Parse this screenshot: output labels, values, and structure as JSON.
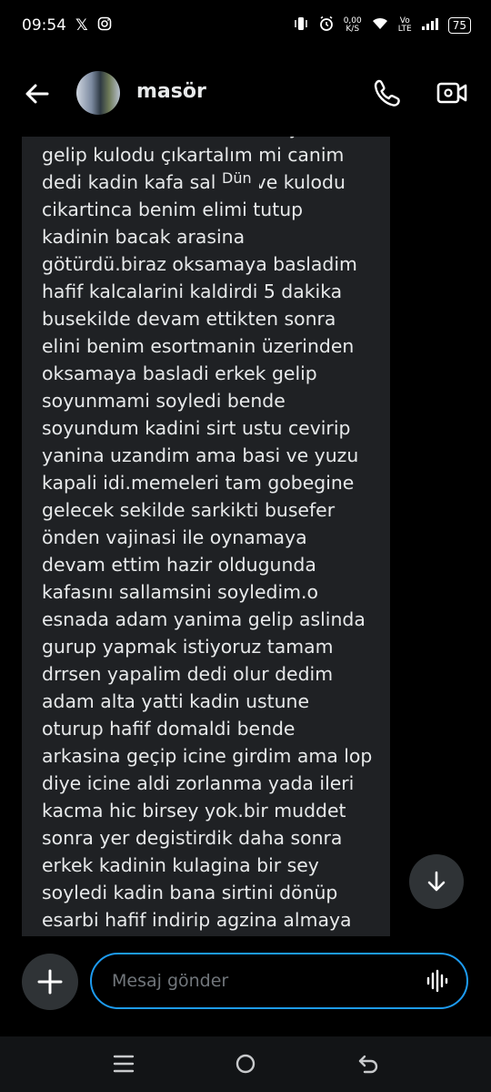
{
  "status_bar": {
    "time": "09:54",
    "speed_value": "0,00",
    "speed_unit": "K/S",
    "volte_top": "Vo",
    "volte_bottom": "LTE",
    "battery": "75",
    "icons": [
      "x-logo-icon",
      "instagram-icon",
      "vibrate-icon",
      "alarm-icon",
      "wifi-icon",
      "signal-icon",
      "battery-icon"
    ]
  },
  "header": {
    "contact_name": "masör",
    "icons": [
      "back-arrow-icon",
      "phone-icon",
      "video-call-icon"
    ]
  },
  "conversation": {
    "day_label": "Dün",
    "message_text": "bakarakdiadu sonra erkek yanimiza\ngelip kulodu çıkartalım mi canim\ndedi kadin kafa salladi ve kulodu\ncikartinca benim elimi tutup\nkadinin bacak arasina\ngötürdü.biraz oksamaya basladim\nhafif kalcalarini kaldirdi  5 dakika\nbusekilde devam ettikten sonra\nelini benim esortmanin üzerinden\noksamaya basladi erkek gelip\nsoyunmami soyledi bende\nsoyundum kadini sirt ustu cevirip\nyanina uzandim ama basi ve yuzu\nkapali idi.memeleri tam gobegine\ngelecek sekilde sarkikti busefer\nönden vajinasi ile oynamaya\ndevam ettim hazir oldugunda\nkafasını sallamsini soyledim.o\nesnada adam yanima gelip aslinda\ngurup yapmak istiyoruz tamam\ndrrsen yapalim dedi olur dedim\nadam alta yatti kadin ustune\noturup hafif domaldi bende\narkasina geçip icine girdim ama lop\ndiye icine aldi zorlanma yada ileri\nkacma hic birsey yok.bir muddet\nsonra yer degistirdik daha sonra\nerkek kadinin kulagina bir sey\nsoyledi kadin bana sirtini dönüp\nesarbi hafif indirip agzina almaya"
  },
  "composer": {
    "placeholder": "Mesaj gönder"
  },
  "colors": {
    "background": "#000000",
    "bubble": "#1f2124",
    "accent": "#1d9bf0",
    "text": "#e7e9ea",
    "muted": "#71767b"
  }
}
